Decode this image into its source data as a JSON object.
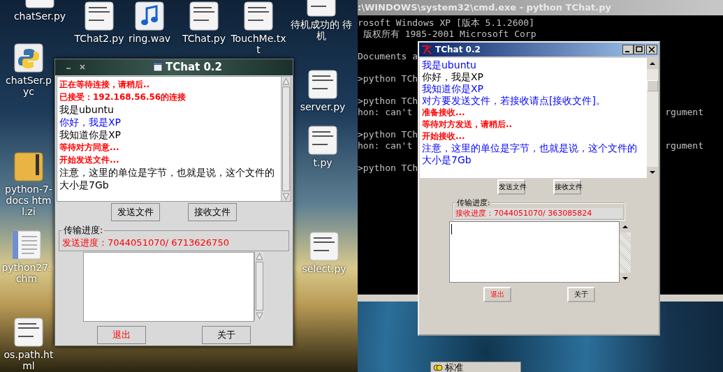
{
  "left_screen": {
    "desktop_icons": [
      {
        "label": "chatSer.py",
        "kind": "text"
      },
      {
        "label": "TChat2.py",
        "kind": "text"
      },
      {
        "label": "ring.wav",
        "kind": "audio"
      },
      {
        "label": "TChat.py",
        "kind": "text"
      },
      {
        "label": "TouchMe.txt",
        "kind": "text"
      },
      {
        "label": "待机成功的 待机",
        "kind": "text"
      },
      {
        "label": "chatSer.pyc",
        "kind": "python"
      },
      {
        "label": "python-7-docs html.zi",
        "kind": "zip"
      },
      {
        "label": "python27.chm",
        "kind": "document"
      },
      {
        "label": "os.path.html",
        "kind": "text"
      },
      {
        "label": "server.py",
        "kind": "text"
      },
      {
        "label": "t.py",
        "kind": "text"
      },
      {
        "label": "select.py",
        "kind": "text"
      }
    ],
    "chat_window": {
      "title": "TChat 0.2",
      "messages": [
        {
          "kind": "system",
          "text": "正在等待连接，请稍后.."
        },
        {
          "kind": "system",
          "text": "已接受：192.168.56.56的连接"
        },
        {
          "kind": "self",
          "text": "我是ubuntu"
        },
        {
          "kind": "peer",
          "text": "你好，我是XP"
        },
        {
          "kind": "self",
          "text": "我知道你是XP"
        },
        {
          "kind": "system",
          "text": "等待对方同意..."
        },
        {
          "kind": "system",
          "text": "开始发送文件..."
        },
        {
          "kind": "self",
          "text": "注意，这里的单位是字节，也就是说，这个文件的大小是7Gb"
        }
      ],
      "send_button": "发送文件",
      "receive_button": "接收文件",
      "progress_label": "传输进度:",
      "progress_text": "发送进度：7044051070/ 6713626750",
      "quit_button": "退出",
      "about_button": "关于"
    }
  },
  "right_screen": {
    "console_window": {
      "title": ":\\WINDOWS\\system32\\cmd.exe - python TChat.py",
      "blocks": [
        [
          {
            "text": "rosoft Windows XP [版本 5.1.2600]"
          },
          {
            "text": " 版权所有 1985-2001 Microsoft Corp"
          }
        ],
        [
          {
            "text": "Documents a"
          }
        ],
        [
          {
            "text": ">python TCh"
          }
        ],
        [
          {
            "text": ">python TCh"
          },
          {
            "text": "hon: can't",
            "tail": "rgument"
          }
        ],
        [
          {
            "text": ">python TCh"
          },
          {
            "text": "hon: can't",
            "tail": "rgument"
          }
        ],
        [
          {
            "text": ">python TCh"
          }
        ]
      ]
    },
    "chat_window": {
      "title": "TChat 0.2",
      "messages": [
        {
          "kind": "peer",
          "text": "我是ubuntu"
        },
        {
          "kind": "self",
          "text": "你好，我是XP"
        },
        {
          "kind": "peer",
          "text": "我知道你是XP"
        },
        {
          "kind": "peer",
          "text": "对方要发送文件，若接收请点[接收文件]。"
        },
        {
          "kind": "system",
          "text": "准备接收..."
        },
        {
          "kind": "system",
          "text": "等待对方发送，请稍后.."
        },
        {
          "kind": "system",
          "text": "开始接收..."
        },
        {
          "kind": "peer",
          "text": "注意，这里的单位是字节，也就是说，这个文件的大小是7Gb"
        }
      ],
      "send_button": "发送文件",
      "receive_button": "接收文件",
      "progress_label": "传输进度:",
      "progress_text": "接收进度：7044051070/ 363085824",
      "quit_button": "退出",
      "about_button": "关于"
    },
    "language_bar": {
      "label": "标准"
    }
  }
}
